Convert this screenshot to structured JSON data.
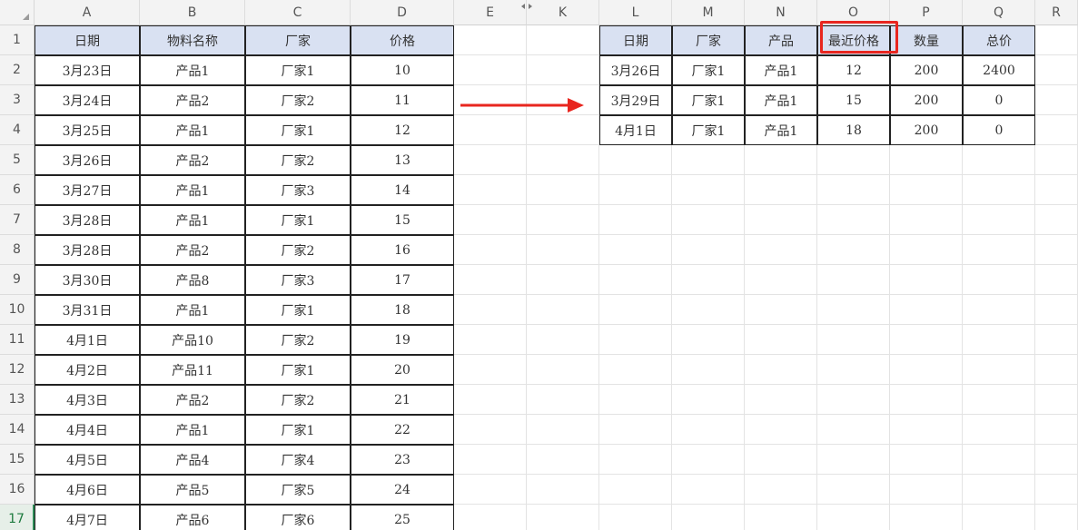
{
  "columns": [
    "A",
    "B",
    "C",
    "D",
    "E",
    "K",
    "L",
    "M",
    "N",
    "O",
    "P",
    "Q",
    "R"
  ],
  "rows": [
    "1",
    "2",
    "3",
    "4",
    "5",
    "6",
    "7",
    "8",
    "9",
    "10",
    "11",
    "12",
    "13",
    "14",
    "15",
    "16",
    "17"
  ],
  "left_table": {
    "headers": [
      "日期",
      "物料名称",
      "厂家",
      "价格"
    ],
    "rows": [
      [
        "3月23日",
        "产品1",
        "厂家1",
        "10"
      ],
      [
        "3月24日",
        "产品2",
        "厂家2",
        "11"
      ],
      [
        "3月25日",
        "产品1",
        "厂家1",
        "12"
      ],
      [
        "3月26日",
        "产品2",
        "厂家2",
        "13"
      ],
      [
        "3月27日",
        "产品1",
        "厂家3",
        "14"
      ],
      [
        "3月28日",
        "产品1",
        "厂家1",
        "15"
      ],
      [
        "3月28日",
        "产品2",
        "厂家2",
        "16"
      ],
      [
        "3月30日",
        "产品8",
        "厂家3",
        "17"
      ],
      [
        "3月31日",
        "产品1",
        "厂家1",
        "18"
      ],
      [
        "4月1日",
        "产品10",
        "厂家2",
        "19"
      ],
      [
        "4月2日",
        "产品11",
        "厂家1",
        "20"
      ],
      [
        "4月3日",
        "产品2",
        "厂家2",
        "21"
      ],
      [
        "4月4日",
        "产品1",
        "厂家1",
        "22"
      ],
      [
        "4月5日",
        "产品4",
        "厂家4",
        "23"
      ],
      [
        "4月6日",
        "产品5",
        "厂家5",
        "24"
      ],
      [
        "4月7日",
        "产品6",
        "厂家6",
        "25"
      ]
    ]
  },
  "right_table": {
    "headers": [
      "日期",
      "厂家",
      "产品",
      "最近价格",
      "数量",
      "总价"
    ],
    "rows": [
      [
        "3月26日",
        "厂家1",
        "产品1",
        "12",
        "200",
        "2400"
      ],
      [
        "3月29日",
        "厂家1",
        "产品1",
        "15",
        "200",
        "0"
      ],
      [
        "4月1日",
        "厂家1",
        "产品1",
        "18",
        "200",
        "0"
      ]
    ]
  },
  "colors": {
    "header_fill": "#d9e1f2",
    "highlight": "#e8261f",
    "arrow": "#e8261f",
    "active_row": "#1d7a3e"
  },
  "active_row": "17",
  "icons": [
    "select-all-triangle-icon",
    "hidden-columns-divider-icon",
    "red-arrow-annotation",
    "red-box-annotation"
  ]
}
